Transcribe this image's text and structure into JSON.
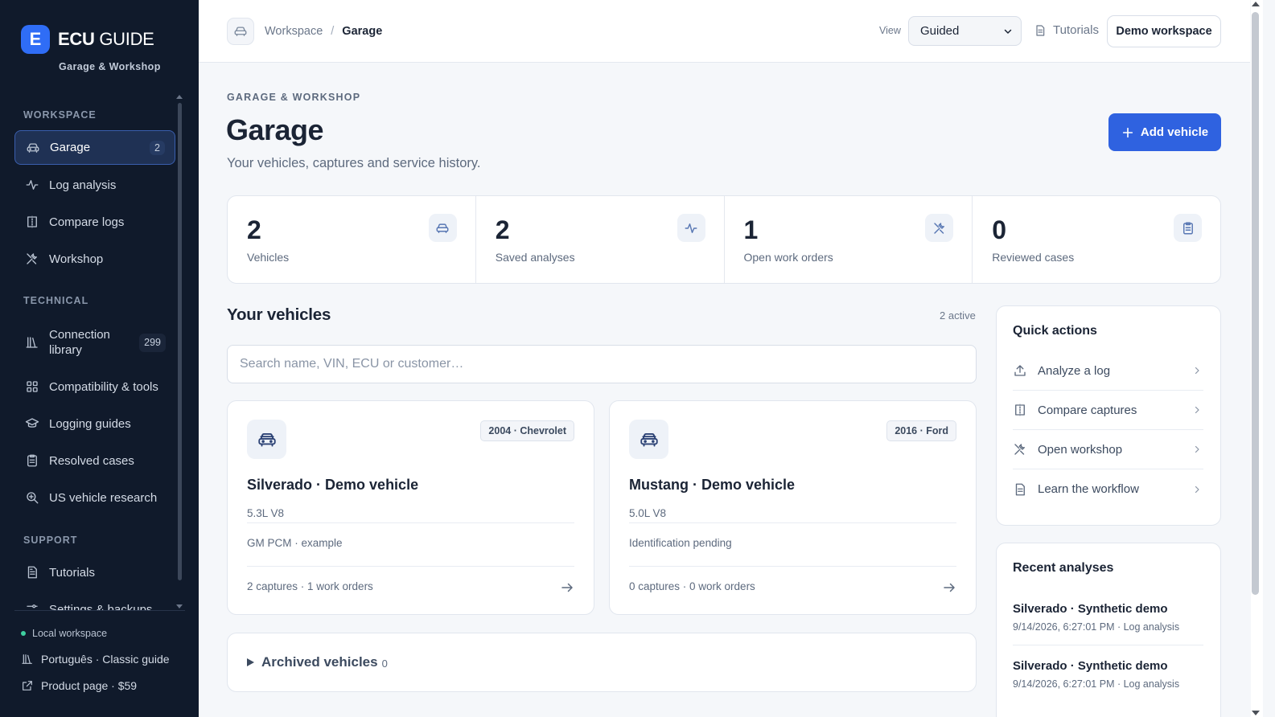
{
  "brand": {
    "logo_letter": "E",
    "name_bold": "ECU",
    "name_rest": "GUIDE",
    "subtitle": "Garage & Workshop"
  },
  "sidebar": {
    "sections": [
      {
        "label": "WORKSPACE"
      },
      {
        "label": "TECHNICAL"
      },
      {
        "label": "SUPPORT"
      }
    ],
    "items": [
      {
        "label": "Garage",
        "badge": "2",
        "icon": "car-icon",
        "active": true
      },
      {
        "label": "Log analysis",
        "icon": "activity-icon"
      },
      {
        "label": "Compare logs",
        "icon": "compare-icon"
      },
      {
        "label": "Workshop",
        "icon": "tools-icon"
      },
      {
        "label": "Connection library",
        "badge": "299",
        "icon": "library-icon"
      },
      {
        "label": "Compatibility & tools",
        "icon": "grid-icon"
      },
      {
        "label": "Logging guides",
        "icon": "graduation-cap-icon"
      },
      {
        "label": "Resolved cases",
        "icon": "clipboard-icon"
      },
      {
        "label": "US vehicle research",
        "icon": "search-zoom-icon"
      },
      {
        "label": "Tutorials",
        "icon": "document-icon"
      },
      {
        "label": "Settings & backups",
        "icon": "sliders-icon"
      }
    ],
    "footer": {
      "local_workspace": "Local workspace",
      "language": "Português · Classic guide",
      "product_page": "Product page · $59"
    }
  },
  "topbar": {
    "breadcrumb": {
      "parent": "Workspace",
      "separator": "/",
      "current": "Garage"
    },
    "view_label": "View",
    "view_selected": "Guided",
    "tutorials_label": "Tutorials",
    "demo_button": "Demo workspace"
  },
  "main": {
    "eyebrow": "GARAGE & WORKSHOP",
    "title": "Garage",
    "subtitle": "Your vehicles, captures and service history.",
    "add_button": "Add vehicle",
    "stats": [
      {
        "value": "2",
        "label": "Vehicles",
        "icon": "car-icon"
      },
      {
        "value": "2",
        "label": "Saved analyses",
        "icon": "activity-icon"
      },
      {
        "value": "1",
        "label": "Open work orders",
        "icon": "tools-icon"
      },
      {
        "value": "0",
        "label": "Reviewed cases",
        "icon": "clipboard-icon"
      }
    ],
    "vehicles_title": "Your vehicles",
    "vehicles_count": "2 active",
    "search_placeholder": "Search name, VIN, ECU or customer…",
    "vehicles": [
      {
        "tag": "2004 · Chevrolet",
        "name": "Silverado · Demo vehicle",
        "engine": "5.3L V8",
        "ecu": "GM PCM · example",
        "meta": "2 captures · 1 work orders"
      },
      {
        "tag": "2016 · Ford",
        "name": "Mustang · Demo vehicle",
        "engine": "5.0L V8",
        "ecu": "Identification pending",
        "meta": "0 captures · 0 work orders"
      }
    ],
    "archived_title": "Archived vehicles",
    "archived_count": "0"
  },
  "quick_actions": {
    "title": "Quick actions",
    "items": [
      {
        "label": "Analyze a log",
        "icon": "upload-icon"
      },
      {
        "label": "Compare captures",
        "icon": "compare-icon"
      },
      {
        "label": "Open workshop",
        "icon": "tools-icon"
      },
      {
        "label": "Learn the workflow",
        "icon": "document-icon"
      }
    ]
  },
  "recent_analyses": {
    "title": "Recent analyses",
    "items": [
      {
        "title": "Silverado · Synthetic demo",
        "meta": "9/14/2026, 6:27:01 PM · Log analysis"
      },
      {
        "title": "Silverado · Synthetic demo",
        "meta": "9/14/2026, 6:27:01 PM · Log analysis"
      }
    ]
  },
  "colors": {
    "sidebar_bg": "#101a2b",
    "accent": "#2f62e0",
    "online_dot": "#3fd0a0"
  }
}
